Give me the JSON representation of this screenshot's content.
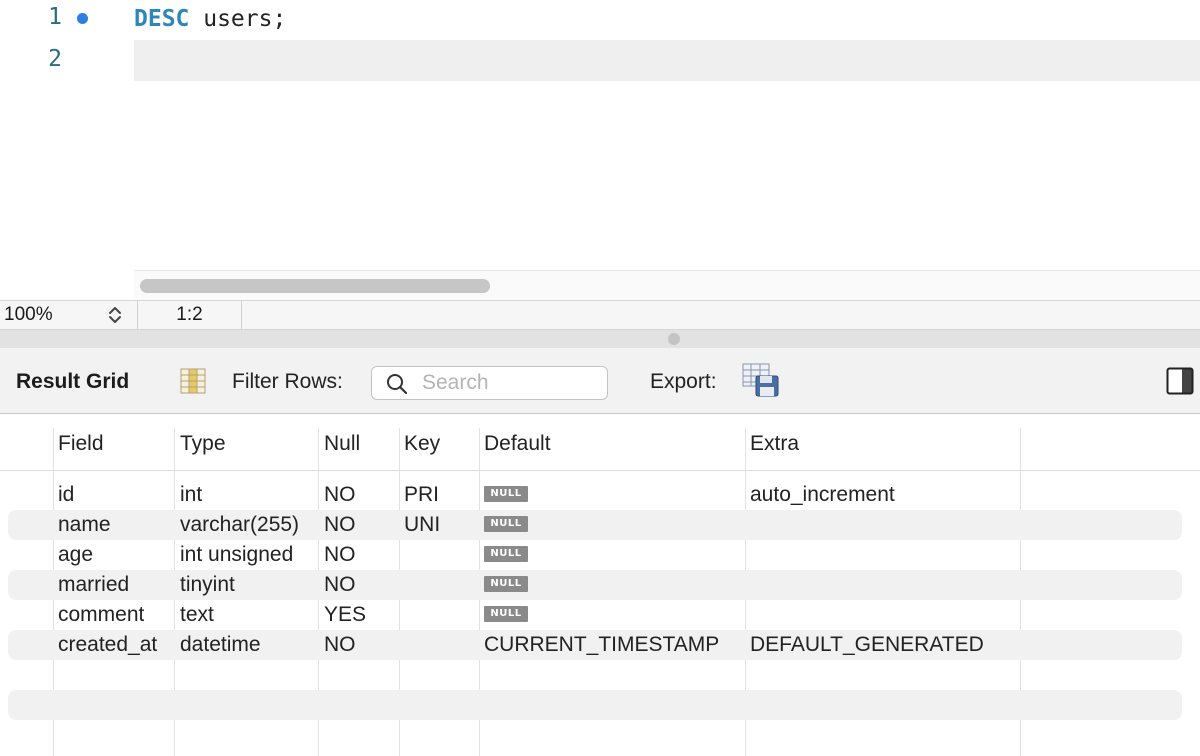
{
  "editor": {
    "lines": [
      {
        "number": "1",
        "keyword": "DESC",
        "text": " users;"
      },
      {
        "number": "2",
        "keyword": "",
        "text": ""
      }
    ]
  },
  "statusbar": {
    "zoom": "100%",
    "cursor_position": "1:2"
  },
  "toolbar": {
    "result_grid_label": "Result Grid",
    "filter_rows_label": "Filter Rows:",
    "search_placeholder": "Search",
    "export_label": "Export:"
  },
  "grid": {
    "columns": [
      "Field",
      "Type",
      "Null",
      "Key",
      "Default",
      "Extra"
    ],
    "rows": [
      {
        "field": "id",
        "type": "int",
        "null": "NO",
        "key": "PRI",
        "default": "NULL",
        "default_is_null": true,
        "extra": "auto_increment"
      },
      {
        "field": "name",
        "type": "varchar(255)",
        "null": "NO",
        "key": "UNI",
        "default": "NULL",
        "default_is_null": true,
        "extra": ""
      },
      {
        "field": "age",
        "type": "int unsigned",
        "null": "NO",
        "key": "",
        "default": "NULL",
        "default_is_null": true,
        "extra": ""
      },
      {
        "field": "married",
        "type": "tinyint",
        "null": "NO",
        "key": "",
        "default": "NULL",
        "default_is_null": true,
        "extra": ""
      },
      {
        "field": "comment",
        "type": "text",
        "null": "YES",
        "key": "",
        "default": "NULL",
        "default_is_null": true,
        "extra": ""
      },
      {
        "field": "created_at",
        "type": "datetime",
        "null": "NO",
        "key": "",
        "default": "CURRENT_TIMESTAMP",
        "default_is_null": false,
        "extra": "DEFAULT_GENERATED"
      }
    ]
  },
  "icons": {
    "breakpoint": "breakpoint-dot-icon",
    "zoom_stepper": "chevron-up-down-icon",
    "form_editor": "column-grid-icon",
    "search": "search-icon",
    "export": "table-save-icon",
    "panel_toggle": "side-panel-icon"
  },
  "colors": {
    "keyword": "#2f86b9",
    "line_number": "#2a6b86",
    "breakpoint": "#2f7fe0",
    "null_badge": "#8a8a8a"
  }
}
